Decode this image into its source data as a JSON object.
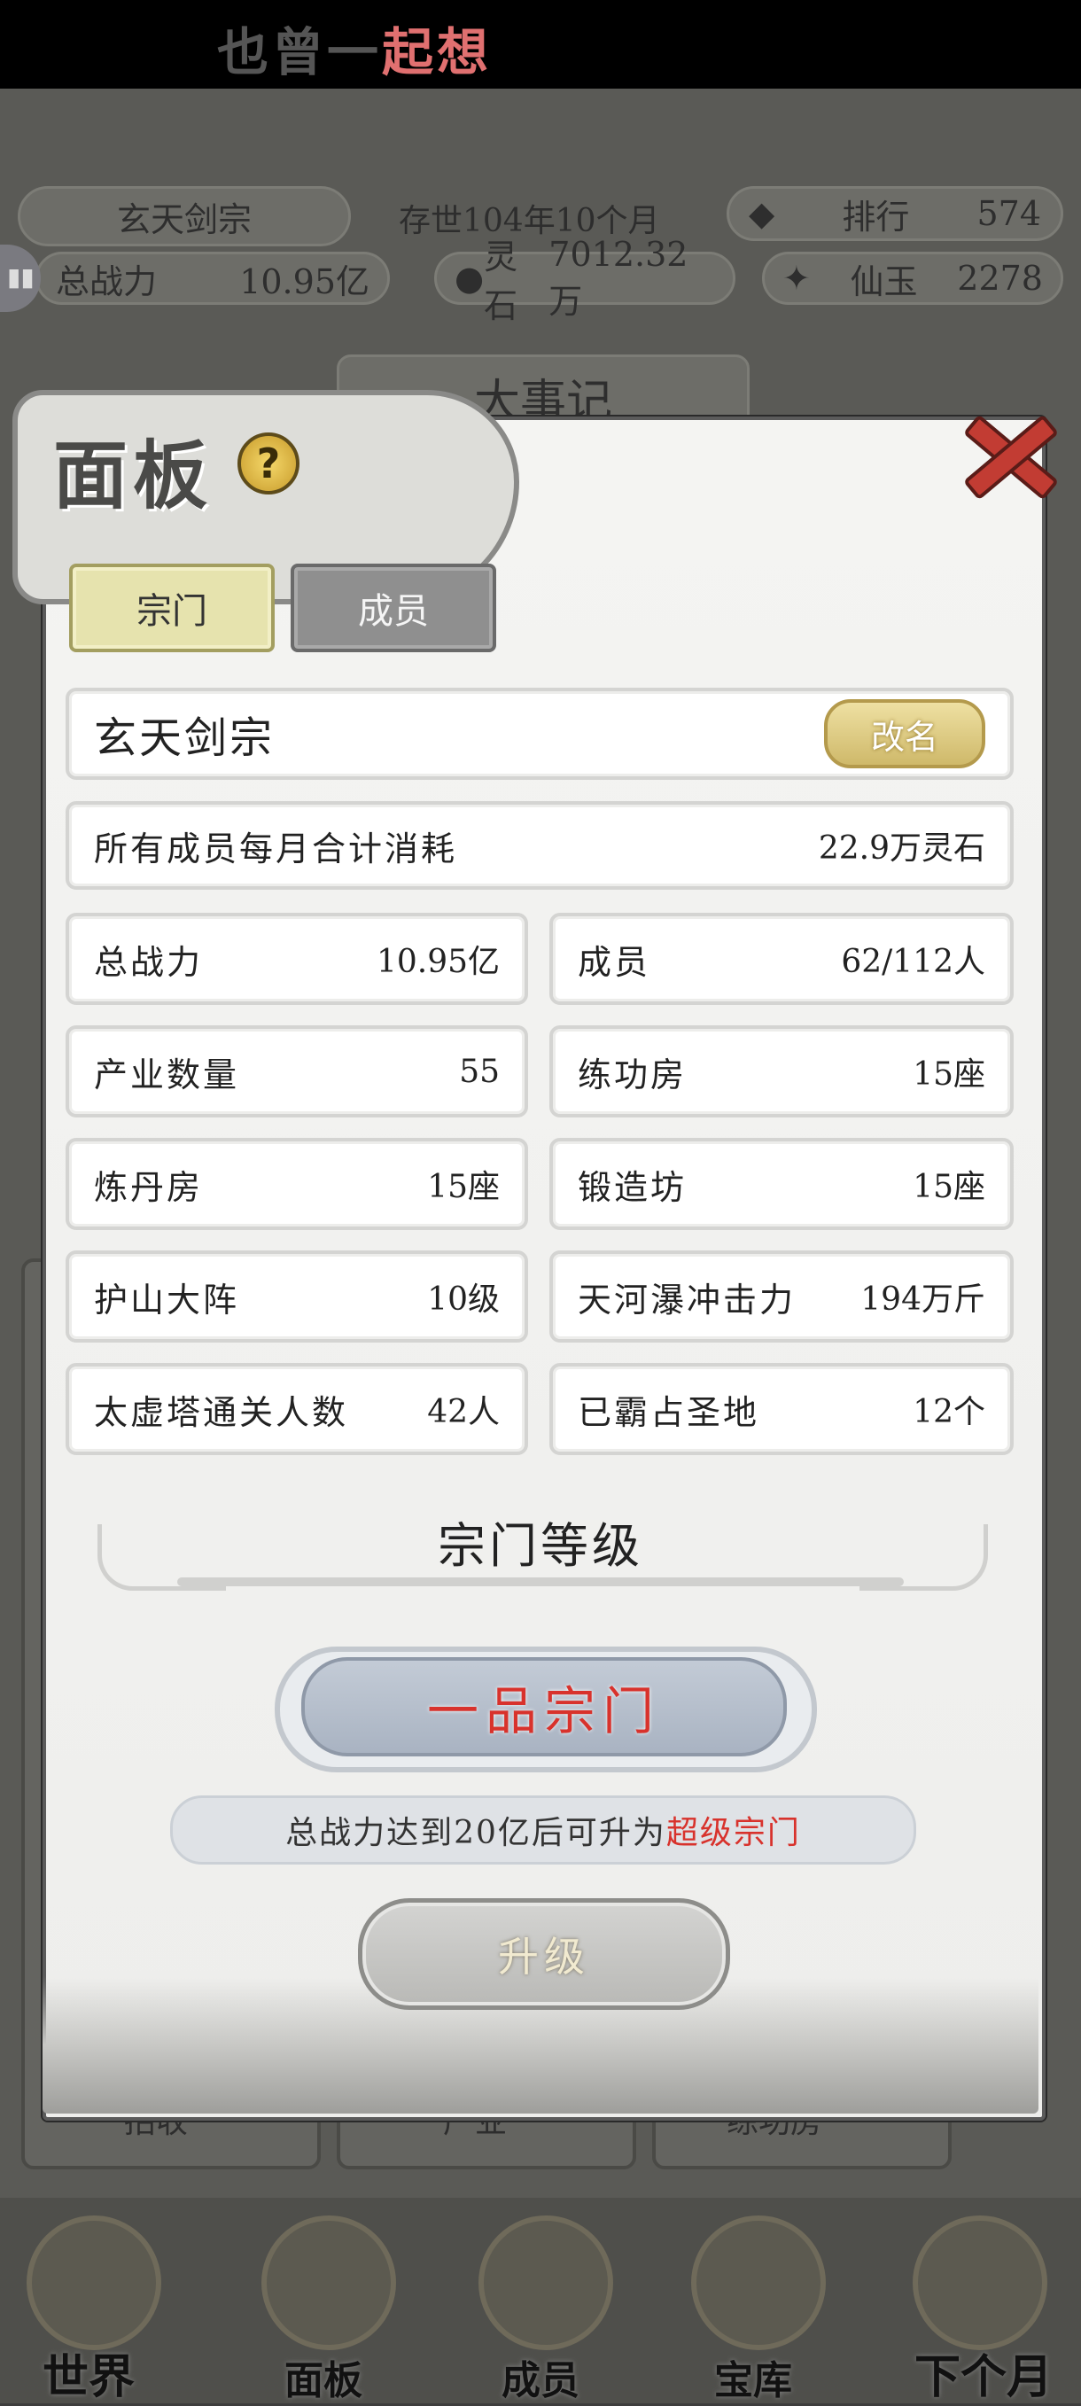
{
  "song_lyric": {
    "dim": "也曾一",
    "highlight": "起想"
  },
  "header_bar": {
    "sect_name": "玄天剑宗",
    "age": "存世104年10个月",
    "rank_label": "排行",
    "rank_value": "574",
    "power_label": "总战力",
    "power_value": "10.95亿",
    "spirit_label": "灵石",
    "spirit_value": "7012.32万",
    "jade_label": "仙玉",
    "jade_value": "2278"
  },
  "background": {
    "chronicle": "大事记",
    "bottom_cards": [
      "招收",
      "产业",
      "练功房"
    ]
  },
  "bottom_nav": [
    {
      "label": "世界"
    },
    {
      "label": "面板"
    },
    {
      "label": "成员"
    },
    {
      "label": "宝库"
    },
    {
      "label": "下个月"
    }
  ],
  "panel": {
    "title": "面板",
    "help_symbol": "?",
    "tabs": {
      "sect": "宗门",
      "members": "成员"
    },
    "sect_name": "玄天剑宗",
    "rename_label": "改名",
    "monthly_cost": {
      "label": "所有成员每月合计消耗",
      "value": "22.9万灵石"
    },
    "stats": [
      {
        "label": "总战力",
        "value": "10.95亿"
      },
      {
        "label": "成员",
        "value": "62/112人"
      },
      {
        "label": "产业数量",
        "value": "55"
      },
      {
        "label": "练功房",
        "value": "15座"
      },
      {
        "label": "炼丹房",
        "value": "15座"
      },
      {
        "label": "锻造坊",
        "value": "15座"
      },
      {
        "label": "护山大阵",
        "value": "10级"
      },
      {
        "label": "天河瀑冲击力",
        "value": "194万斤"
      },
      {
        "label": "太虚塔通关人数",
        "value": "42人"
      },
      {
        "label": "已霸占圣地",
        "value": "12个"
      }
    ],
    "level_section_title": "宗门等级",
    "current_level": "一品宗门",
    "hint_prefix": "总战力达到20亿后可升为",
    "hint_target": "超级宗门",
    "upgrade_label": "升级"
  },
  "colors": {
    "accent_red": "#d8322c",
    "tab_active": "#e6e3ae",
    "tab_inactive": "#8f8f8f",
    "rename_gold": "#cfb96a"
  }
}
